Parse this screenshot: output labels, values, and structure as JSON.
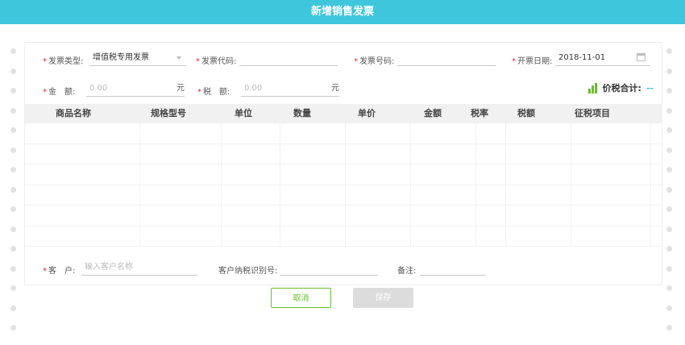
{
  "title": "新增销售发票",
  "row1": {
    "invoice_type": {
      "label": "发票类型:",
      "value": "增值税专用发票"
    },
    "invoice_code": {
      "label": "发票代码:",
      "value": ""
    },
    "invoice_number": {
      "label": "发票号码:",
      "value": ""
    },
    "invoice_date": {
      "label": "开票日期:",
      "value": "2018-11-01"
    }
  },
  "row2": {
    "amount": {
      "label": "金　额:",
      "placeholder": "0.00",
      "unit": "元"
    },
    "tax": {
      "label": "税　额:",
      "placeholder": "0.00",
      "unit": "元"
    },
    "total": {
      "label": "价税合计:",
      "value": "--"
    }
  },
  "table": {
    "headers": [
      "商品名称",
      "规格型号",
      "单位",
      "数量",
      "单价",
      "金额",
      "税率",
      "税额",
      "征税项目"
    ],
    "rows": 6
  },
  "bottom": {
    "customer": {
      "label": "客　户:",
      "placeholder": "输入客户名称"
    },
    "tax_id": {
      "label": "客户纳税识别号:",
      "value": ""
    },
    "remark": {
      "label": "备注:",
      "value": ""
    }
  },
  "buttons": {
    "cancel": "取消",
    "save": "保存"
  },
  "colors": {
    "header_bg": "#3ec6dd",
    "accent_green": "#6cbe2c",
    "required_red": "#e23"
  }
}
